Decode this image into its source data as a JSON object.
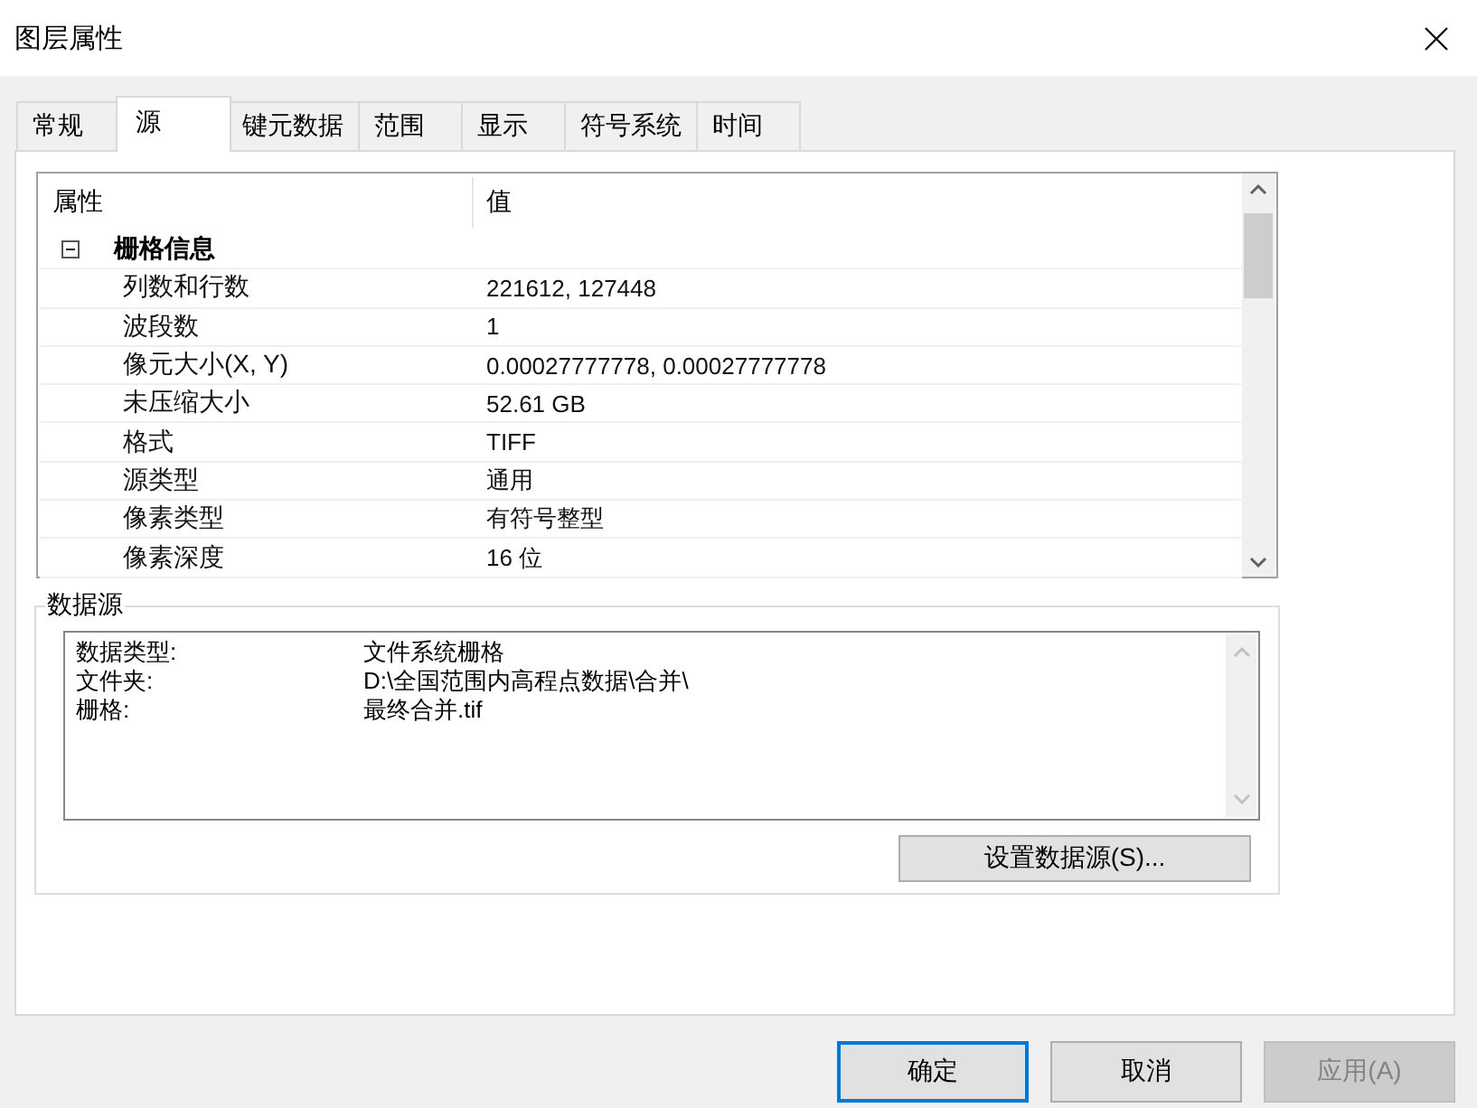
{
  "window": {
    "title": "图层属性"
  },
  "tabs": [
    {
      "label": "常规",
      "selected": false
    },
    {
      "label": "源",
      "selected": true
    },
    {
      "label": "键元数据",
      "selected": false
    },
    {
      "label": "范围",
      "selected": false
    },
    {
      "label": "显示",
      "selected": false
    },
    {
      "label": "符号系统",
      "selected": false
    },
    {
      "label": "时间",
      "selected": false
    }
  ],
  "property_grid": {
    "columns": [
      "属性",
      "值"
    ],
    "groups": [
      {
        "label": "栅格信息",
        "expanded": true,
        "rows": [
          {
            "name": "列数和行数",
            "value": "221612, 127448"
          },
          {
            "name": "波段数",
            "value": "1"
          },
          {
            "name": "像元大小(X, Y)",
            "value": "0.00027777778, 0.00027777778"
          },
          {
            "name": "未压缩大小",
            "value": "52.61 GB"
          },
          {
            "name": "格式",
            "value": "TIFF"
          },
          {
            "name": "源类型",
            "value": "通用"
          },
          {
            "name": "像素类型",
            "value": "有符号整型"
          },
          {
            "name": "像素深度",
            "value": "16 位"
          }
        ]
      }
    ]
  },
  "data_source": {
    "title": "数据源",
    "entries": [
      {
        "label": "数据类型:",
        "value": "文件系统栅格"
      },
      {
        "label": "文件夹:",
        "value": "D:\\全国范围内高程点数据\\合并\\"
      },
      {
        "label": "栅格:",
        "value": "最终合并.tif"
      }
    ],
    "button": "设置数据源(S)..."
  },
  "buttons": [
    {
      "label": "确定",
      "default": true,
      "disabled": false
    },
    {
      "label": "取消",
      "default": false,
      "disabled": false
    },
    {
      "label": "应用(A)",
      "default": false,
      "disabled": true
    }
  ]
}
